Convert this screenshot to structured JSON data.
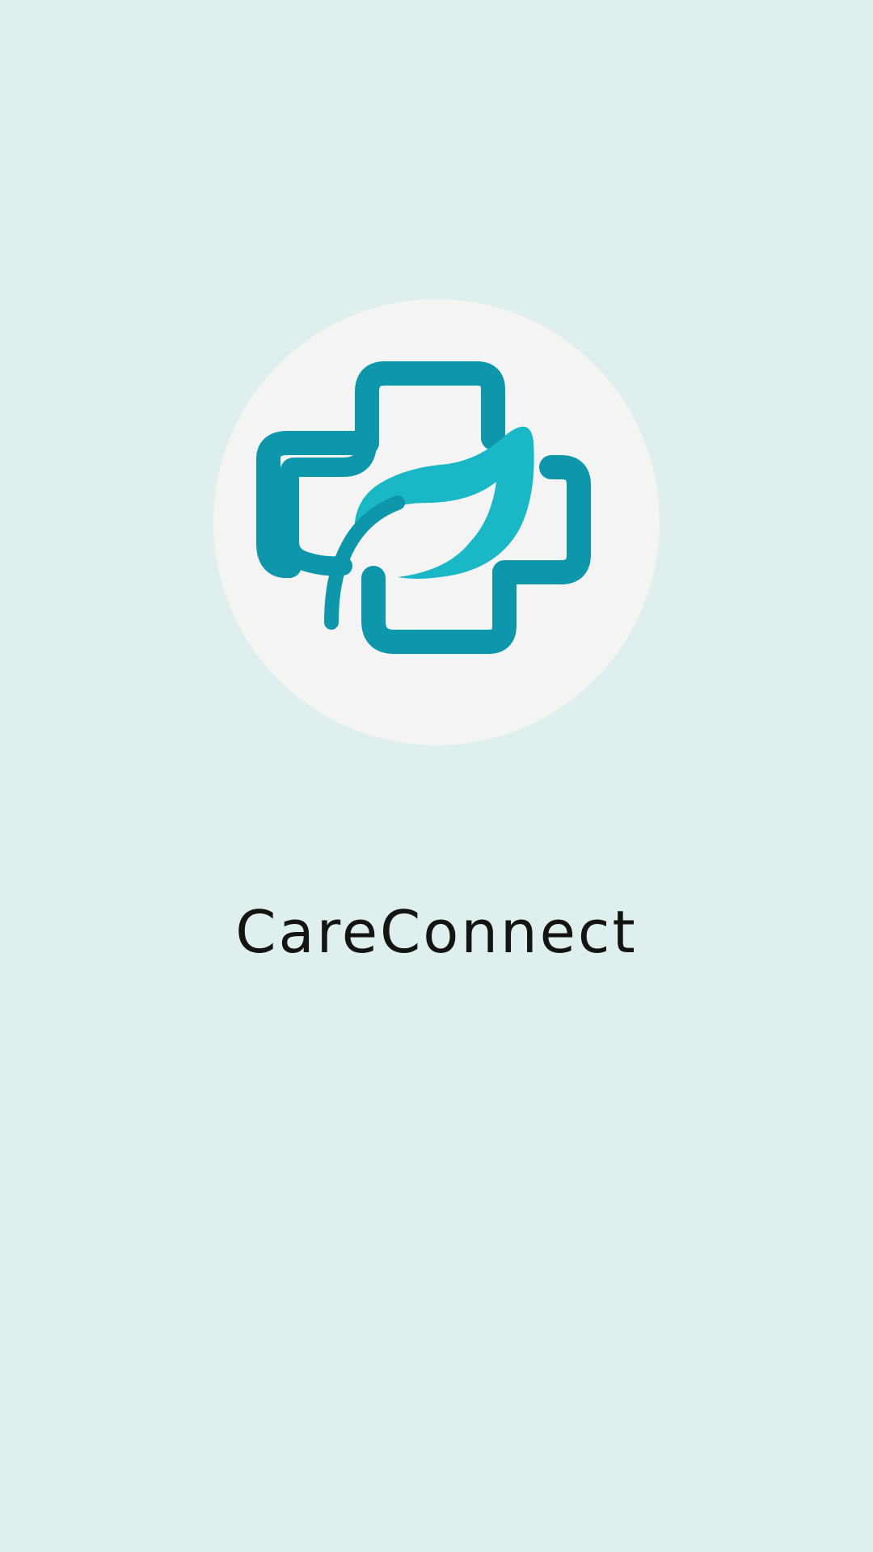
{
  "app": {
    "name": "CareConnect"
  },
  "logo": {
    "icon": "medical-cross-leaf-icon",
    "colors": {
      "cross": "#0E97AA",
      "leaf": "#1AB8C6",
      "circle": "#F4F4F4",
      "background": "#DEEFEE"
    }
  }
}
